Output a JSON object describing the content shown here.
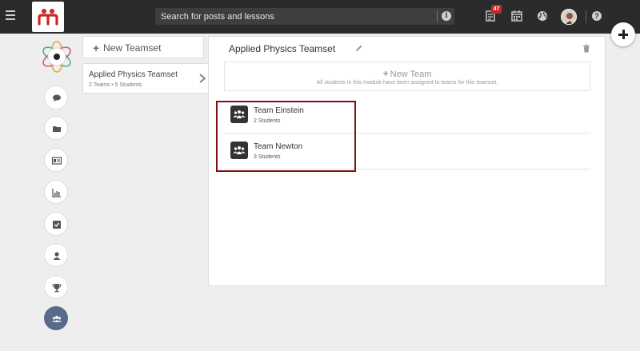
{
  "topbar": {
    "search_placeholder": "Search for posts and lessons",
    "notification_count": "47"
  },
  "teamsets": {
    "new_label": "New Teamset",
    "items": [
      {
        "name": "Applied Physics Teamset",
        "meta": "2 Teams • 5 Students"
      }
    ]
  },
  "panel": {
    "title": "Applied Physics Teamset",
    "new_team_label": "New Team",
    "new_team_note": "All students in this module have been assigned to teams for this teamset.",
    "teams": [
      {
        "name": "Team Einstein",
        "meta": "2 Students"
      },
      {
        "name": "Team Newton",
        "meta": "3 Students"
      }
    ]
  },
  "rail": {
    "items": [
      "chat-icon",
      "folder-icon",
      "id-card-icon",
      "bar-chart-icon",
      "checkbox-icon",
      "user-icon",
      "trophy-icon",
      "group-icon"
    ],
    "active": "group-icon"
  },
  "colors": {
    "topbar": "#2b2b2b",
    "brand": "#c62828",
    "accent": "#5a6a8a",
    "highlight": "#7d1116"
  }
}
